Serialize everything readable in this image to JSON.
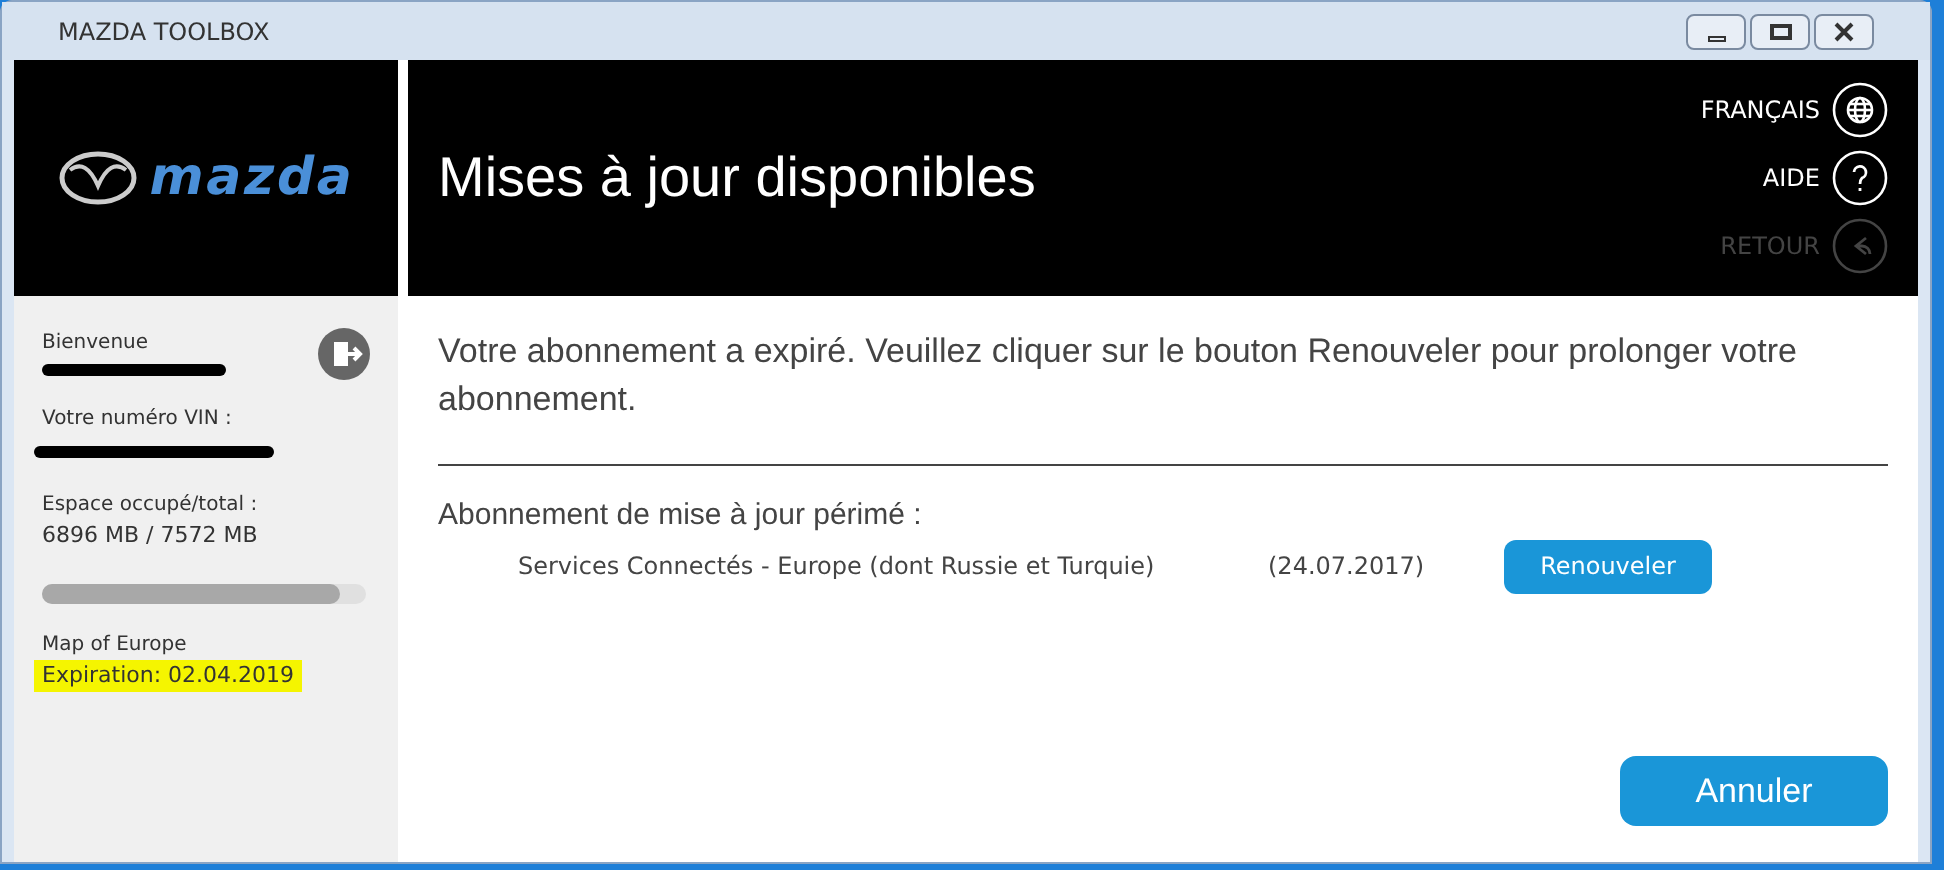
{
  "window": {
    "title": "MAZDA TOOLBOX"
  },
  "logo": {
    "wordmark": "mazda"
  },
  "header": {
    "title": "Mises à jour disponibles",
    "actions": [
      {
        "kind": "language",
        "label": "FRANÇAIS",
        "disabled": false
      },
      {
        "kind": "help",
        "label": "AIDE",
        "disabled": false
      },
      {
        "kind": "back",
        "label": "RETOUR",
        "disabled": true
      }
    ]
  },
  "sidebar": {
    "welcome_label": "Bienvenue",
    "vin_label": "Votre numéro VIN :",
    "storage_label": "Espace occupé/total :",
    "storage_value": "6896 MB / 7572 MB",
    "storage": {
      "level": 0.92
    },
    "map_name": "Map of Europe",
    "expiration": "Expiration: 02.04.2019"
  },
  "message": "Votre abonnement a expiré. Veuillez cliquer sur le bouton Renouveler pour prolonger votre abonnement.",
  "expired": {
    "heading": "Abonnement de mise à jour périmé :",
    "items": [
      {
        "name": "Services Connectés - Europe (dont Russie et Turquie)",
        "date": "(24.07.2017)",
        "button": "Renouveler"
      }
    ]
  },
  "cancel_button": "Annuler"
}
